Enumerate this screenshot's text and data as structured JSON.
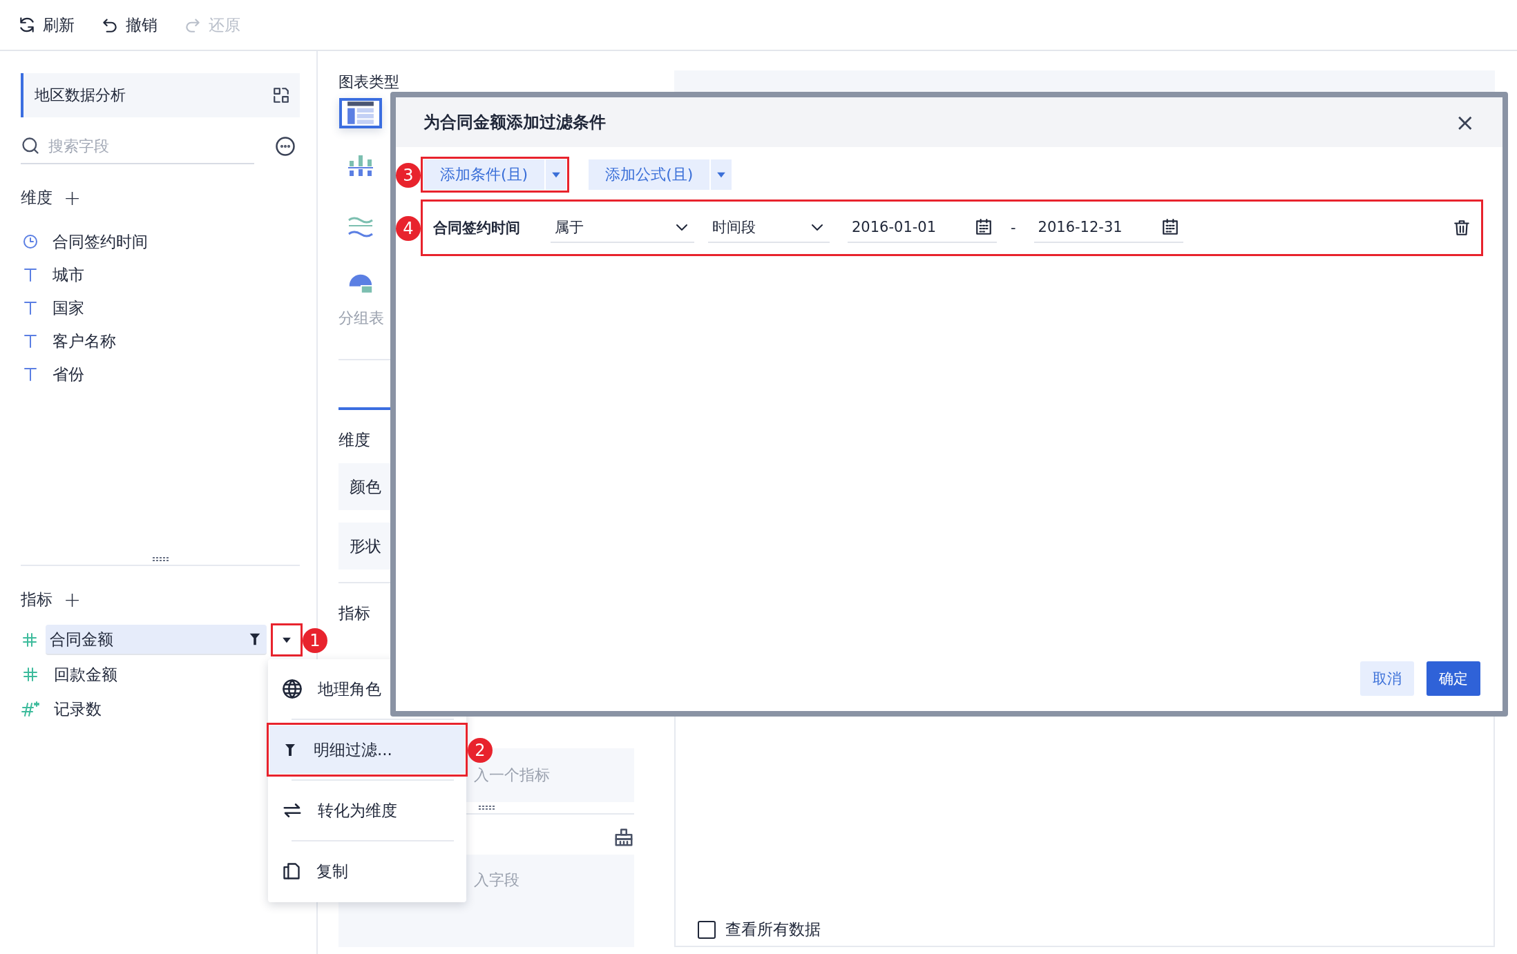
{
  "toolbar": [
    {
      "label": "刷新",
      "disabled": false
    },
    {
      "label": "撤销",
      "disabled": false
    },
    {
      "label": "还原",
      "disabled": true
    }
  ],
  "dataset": {
    "title": "地区数据分析",
    "search_placeholder": "搜索字段"
  },
  "dimensions": {
    "title": "维度",
    "add": "+",
    "fields": [
      {
        "label": "合同签约时间",
        "kind": "time"
      },
      {
        "label": "城市",
        "kind": "text"
      },
      {
        "label": "国家",
        "kind": "text"
      },
      {
        "label": "客户名称",
        "kind": "text"
      },
      {
        "label": "省份",
        "kind": "text"
      }
    ]
  },
  "measures": {
    "title": "指标",
    "add": "+",
    "fields": [
      {
        "label": "合同金额",
        "kind": "number",
        "selected": true,
        "filtered": true
      },
      {
        "label": "回款金额",
        "kind": "number",
        "selected": false,
        "filtered": false
      },
      {
        "label": "记录数",
        "kind": "count",
        "selected": false,
        "filtered": false
      }
    ]
  },
  "context_menu": {
    "items": [
      {
        "label": "地理角色",
        "highlighted": false
      },
      {
        "label": "明细过滤...",
        "highlighted": true
      },
      {
        "label": "转化为维度",
        "highlighted": false
      },
      {
        "label": "复制",
        "highlighted": false
      }
    ]
  },
  "chart_types": {
    "title": "图表类型",
    "caption": "分组表",
    "items": [
      {
        "kind": "table",
        "selected": true
      },
      {
        "kind": "bar",
        "selected": false
      },
      {
        "kind": "line",
        "selected": false
      },
      {
        "kind": "pie",
        "selected": false
      }
    ]
  },
  "config": {
    "dimension_title": "维度",
    "slots": [
      "颜色",
      "形状"
    ],
    "measure_title": "指标",
    "measure_drop": "入一个指标",
    "field_drop": "入字段"
  },
  "result": {
    "view_all": {
      "label": "查看所有数据",
      "checked": false
    }
  },
  "dialog": {
    "title": "为合同金额添加过滤条件",
    "close": "×",
    "add_buttons": [
      "添加条件(且)",
      "添加公式(且)"
    ],
    "conditions": [
      {
        "field": "合同签约时间",
        "operator": "属于",
        "mode": "时间段",
        "start": "2016-01-01",
        "separator": "-",
        "end": "2016-12-31"
      }
    ],
    "buttons": [
      {
        "label": "取消",
        "kind": "secondary"
      },
      {
        "label": "确定",
        "kind": "primary"
      }
    ]
  },
  "annotations": [
    {
      "label": "1"
    },
    {
      "label": "2"
    },
    {
      "label": "3"
    },
    {
      "label": "4"
    }
  ]
}
